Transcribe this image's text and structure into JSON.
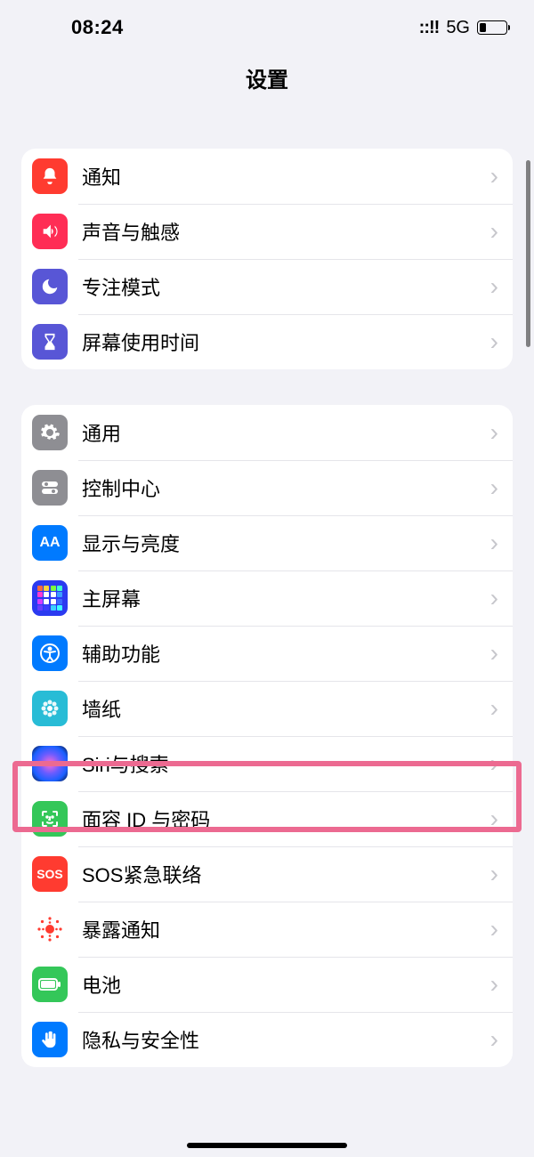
{
  "status": {
    "time": "08:24",
    "signal": "::!!",
    "network": "5G"
  },
  "nav": {
    "title": "设置"
  },
  "sections": [
    {
      "rows": [
        {
          "label": "通知",
          "icon": "bell-icon"
        },
        {
          "label": "声音与触感",
          "icon": "sound-icon"
        },
        {
          "label": "专注模式",
          "icon": "moon-icon"
        },
        {
          "label": "屏幕使用时间",
          "icon": "hourglass-icon"
        }
      ]
    },
    {
      "rows": [
        {
          "label": "通用",
          "icon": "gear-icon"
        },
        {
          "label": "控制中心",
          "icon": "toggles-icon"
        },
        {
          "label": "显示与亮度",
          "icon": "aa-icon"
        },
        {
          "label": "主屏幕",
          "icon": "homegrid-icon"
        },
        {
          "label": "辅助功能",
          "icon": "accessibility-icon"
        },
        {
          "label": "墙纸",
          "icon": "flower-icon"
        },
        {
          "label": "Siri与搜索",
          "icon": "siri-icon"
        },
        {
          "label": "面容 ID 与密码",
          "icon": "faceid-icon"
        },
        {
          "label": "SOS紧急联络",
          "icon": "sos-icon"
        },
        {
          "label": "暴露通知",
          "icon": "exposure-icon"
        },
        {
          "label": "电池",
          "icon": "battery-icon"
        },
        {
          "label": "隐私与安全性",
          "icon": "hand-icon"
        }
      ]
    }
  ],
  "highlighted_row_label": "Siri与搜索"
}
